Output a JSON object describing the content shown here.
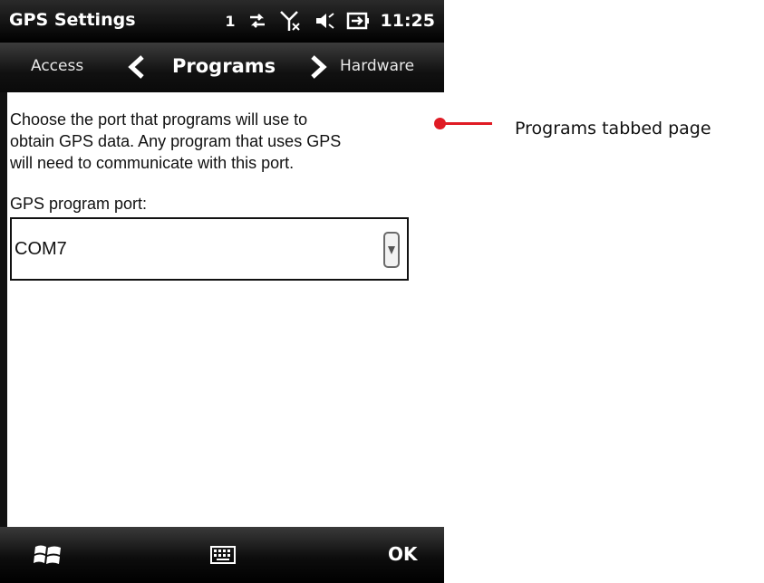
{
  "status_bar": {
    "title": "GPS Settings",
    "indicator": "1",
    "time": "11:25",
    "icons": [
      "data-sync-icon",
      "signal-off-icon",
      "volume-icon",
      "battery-charging-icon"
    ]
  },
  "tabs": {
    "previous": "Access",
    "current": "Programs",
    "next": "Hardware"
  },
  "content": {
    "description": "Choose the port that programs will use to\nobtain GPS data. Any program that uses GPS\nwill need to communicate with this port.",
    "port_label": "GPS program port:",
    "port_value": "COM7"
  },
  "menu_bar": {
    "ok_label": "OK",
    "icons": [
      "windows-start-icon",
      "keyboard-icon"
    ]
  },
  "annotation": {
    "label": "Programs tabbed page",
    "color": "#e01b24"
  }
}
